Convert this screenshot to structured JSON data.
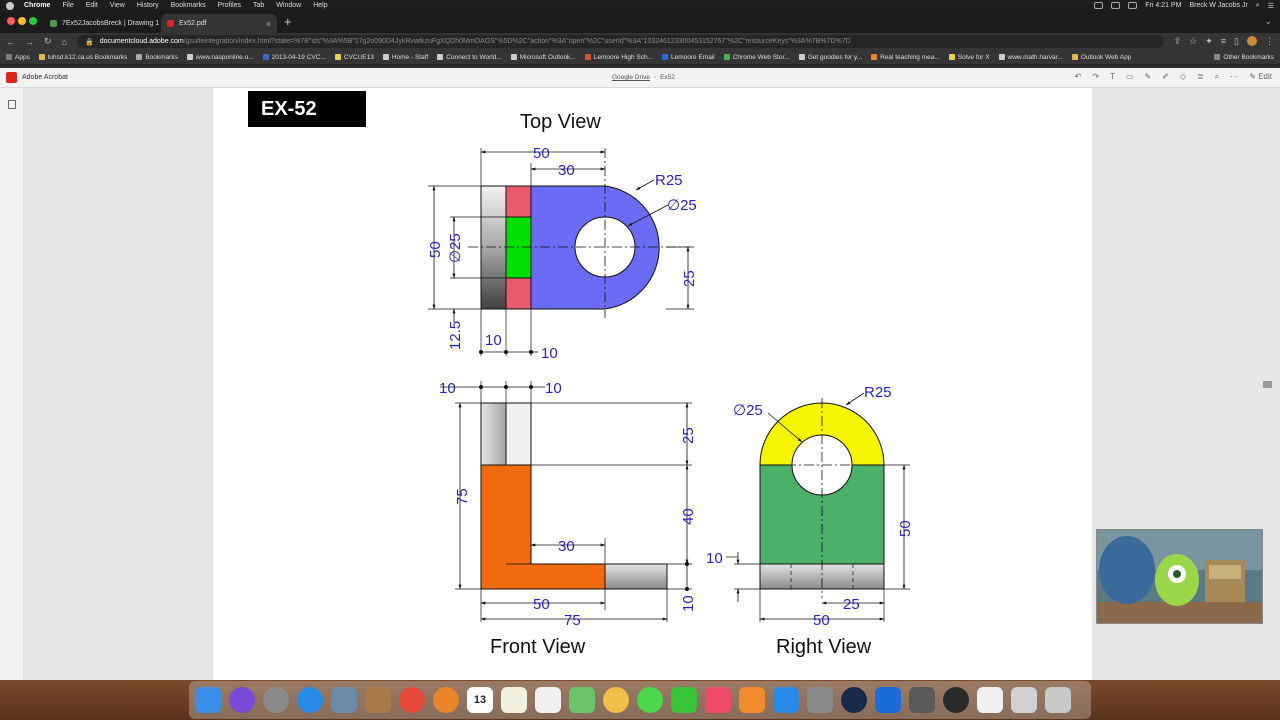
{
  "menubar": {
    "items": [
      "Chrome",
      "File",
      "Edit",
      "View",
      "History",
      "Bookmarks",
      "Profiles",
      "Tab",
      "Window",
      "Help"
    ],
    "clock": "Fri 4:21 PM",
    "user": "Breck W Jacobs Jr"
  },
  "tabs": [
    {
      "title": "7Ex52JacobsBreck | Drawing 1",
      "color": "#4c9a4a"
    },
    {
      "title": "Ex52.pdf",
      "color": "#d8261c"
    }
  ],
  "urlbar": {
    "domain": "documentcloud.adobe.com",
    "path": "/gsuiteintegration/index.html?state=%7B\"ids\"%3A%5B\"17g2o090D4JykRvwtkzuFgXQDh0MmOAOS\"%5D%2C\"action\"%3A\"open\"%2C\"userId\"%3A\"103246123300453152767\"%2C\"resourceKeys\"%3A%7B%7D%7D"
  },
  "bookmarks": {
    "items": [
      {
        "label": "Apps",
        "color": "#7c7c7c"
      },
      {
        "label": "luhsd.k12.ca.us Bookmarks",
        "color": "#e8b84a"
      },
      {
        "label": "Bookmarks",
        "color": "#aaaaaa"
      },
      {
        "label": "www.nasponline.o...",
        "color": "#cccccc"
      },
      {
        "label": "2013-04-19 CVC...",
        "color": "#3a6bc4"
      },
      {
        "label": "CVCUE13",
        "color": "#e8d34a"
      },
      {
        "label": "Home - Staff",
        "color": "#cccccc"
      },
      {
        "label": "Connect to World...",
        "color": "#cccccc"
      },
      {
        "label": "Microsoft Outlook...",
        "color": "#cccccc"
      },
      {
        "label": "Lemoore High Sch...",
        "color": "#d8542a"
      },
      {
        "label": "Lemoore Email",
        "color": "#2a6ad8"
      },
      {
        "label": "Chrome Web Stor...",
        "color": "#4caf50"
      },
      {
        "label": "Get goodies for y...",
        "color": "#cccccc"
      },
      {
        "label": "Real teaching mea...",
        "color": "#e8842a"
      },
      {
        "label": "Solve for X",
        "color": "#e8d34a"
      },
      {
        "label": "www.math.harvar...",
        "color": "#cccccc"
      },
      {
        "label": "Outlook Web App",
        "color": "#e8b84a"
      }
    ],
    "other": "Other Bookmarks"
  },
  "acrobat": {
    "app_name": "Adobe Acrobat",
    "breadcrumb_root": "Google Drive",
    "breadcrumb_file": "Ex52",
    "edit_label": "Edit"
  },
  "drawing": {
    "exercise_label": "EX-52",
    "top_view_title": "Top View",
    "front_view_title": "Front View",
    "right_view_title": "Right View",
    "top_dims": {
      "overall": "50",
      "to_center": "30",
      "radius": "R25",
      "hole": "∅25",
      "height": "50",
      "counterbore": "∅25",
      "half": "25",
      "offset": "12.5",
      "w1": "10",
      "w2": "10"
    },
    "front_dims": {
      "w1": "10",
      "w2": "10",
      "upper": "25",
      "height": "75",
      "mid": "40",
      "foot": "30",
      "base": "50",
      "overall": "75",
      "thick": "10"
    },
    "right_dims": {
      "hole": "∅25",
      "radius": "R25",
      "base_h": "10",
      "height": "50",
      "half": "25",
      "width": "50"
    },
    "colors": {
      "blue_face": "#6b6bf5",
      "red_face": "#e85a6e",
      "green_slot": "#00e000",
      "yellow_arc": "#f5f500",
      "green_body": "#4caf6a",
      "orange_L": "#f06a10",
      "dim_color": "#2525c0"
    }
  },
  "dock": {
    "apps": [
      {
        "name": "finder-app",
        "color": "#3a8ee8"
      },
      {
        "name": "siri-app",
        "color": "#7a4ad8"
      },
      {
        "name": "launchpad-app",
        "color": "#8a8a8a"
      },
      {
        "name": "safari-app",
        "color": "#2a8ae8"
      },
      {
        "name": "preview-app",
        "color": "#6a8aa8"
      },
      {
        "name": "notes-folder-app",
        "color": "#a87a4a"
      },
      {
        "name": "chrome-app",
        "color": "#e84a3a"
      },
      {
        "name": "firefox-app",
        "color": "#e8842a"
      },
      {
        "name": "calendar-app",
        "color": "#ffffff"
      },
      {
        "name": "textedit-app",
        "color": "#f0f0e0"
      },
      {
        "name": "reminders-app",
        "color": "#f0f0f0"
      },
      {
        "name": "maps-app",
        "color": "#6ac46a"
      },
      {
        "name": "photos-app",
        "color": "#f0c04a"
      },
      {
        "name": "messages-app",
        "color": "#4ad84a"
      },
      {
        "name": "facetime-app",
        "color": "#3ac43a"
      },
      {
        "name": "music-app",
        "color": "#f04a6a"
      },
      {
        "name": "books-app",
        "color": "#f08a2a"
      },
      {
        "name": "appstore-app",
        "color": "#2a8ae8"
      },
      {
        "name": "system-prefs-app",
        "color": "#8a8a8a"
      },
      {
        "name": "quicktime-app",
        "color": "#1a2a4a"
      },
      {
        "name": "outlook-app",
        "color": "#1a6ad8"
      },
      {
        "name": "calculator-app",
        "color": "#5a5a5a"
      },
      {
        "name": "screenflow-app",
        "color": "#2a2a2a"
      },
      {
        "name": "documents-app",
        "color": "#f0f0f0"
      },
      {
        "name": "downloads-app",
        "color": "#d0d0d0"
      },
      {
        "name": "trash-app",
        "color": "#c8c8c8"
      }
    ],
    "calendar_day": "13"
  }
}
